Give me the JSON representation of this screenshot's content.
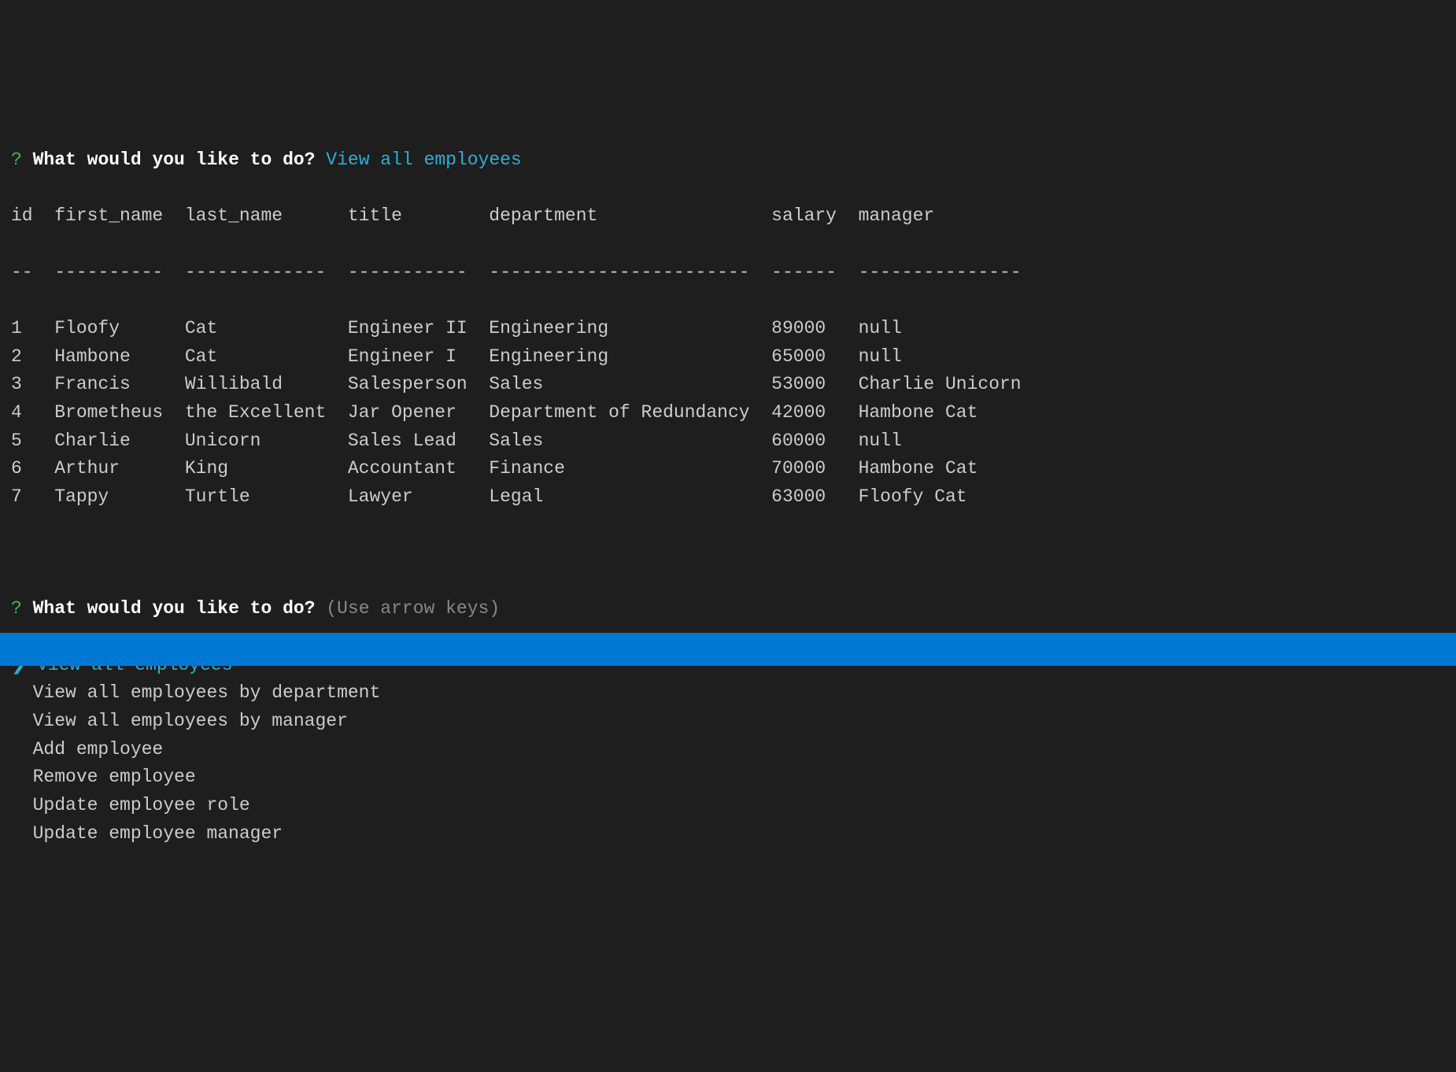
{
  "prompt1": {
    "qmark": "?",
    "question": "What would you like to do?",
    "answer": "View all employees"
  },
  "table": {
    "headers": [
      "id",
      "first_name",
      "last_name",
      "title",
      "department",
      "salary",
      "manager"
    ],
    "divider": [
      "--",
      "----------",
      "-------------",
      "-----------",
      "------------------------",
      "------",
      "---------------"
    ],
    "rows": [
      {
        "id": "1",
        "first_name": "Floofy",
        "last_name": "Cat",
        "title": "Engineer II",
        "department": "Engineering",
        "salary": "89000",
        "manager": "null"
      },
      {
        "id": "2",
        "first_name": "Hambone",
        "last_name": "Cat",
        "title": "Engineer I",
        "department": "Engineering",
        "salary": "65000",
        "manager": "null"
      },
      {
        "id": "3",
        "first_name": "Francis",
        "last_name": "Willibald",
        "title": "Salesperson",
        "department": "Sales",
        "salary": "53000",
        "manager": "Charlie Unicorn"
      },
      {
        "id": "4",
        "first_name": "Brometheus",
        "last_name": "the Excellent",
        "title": "Jar Opener",
        "department": "Department of Redundancy",
        "salary": "42000",
        "manager": "Hambone Cat"
      },
      {
        "id": "5",
        "first_name": "Charlie",
        "last_name": "Unicorn",
        "title": "Sales Lead",
        "department": "Sales",
        "salary": "60000",
        "manager": "null"
      },
      {
        "id": "6",
        "first_name": "Arthur",
        "last_name": "King",
        "title": "Accountant",
        "department": "Finance",
        "salary": "70000",
        "manager": "Hambone Cat"
      },
      {
        "id": "7",
        "first_name": "Tappy",
        "last_name": "Turtle",
        "title": "Lawyer",
        "department": "Legal",
        "salary": "63000",
        "manager": "Floofy Cat"
      }
    ]
  },
  "prompt2": {
    "qmark": "?",
    "question": "What would you like to do?",
    "hint": "(Use arrow keys)",
    "pointer": "❯"
  },
  "menu": {
    "items": [
      {
        "label": "View all employees",
        "selected": true
      },
      {
        "label": "View all employees by department",
        "selected": false
      },
      {
        "label": "View all employees by manager",
        "selected": false
      },
      {
        "label": "Add employee",
        "selected": false
      },
      {
        "label": "Remove employee",
        "selected": false
      },
      {
        "label": "Update employee role",
        "selected": false
      },
      {
        "label": "Update employee manager",
        "selected": false
      }
    ]
  },
  "col_widths": {
    "id": 4,
    "first_name": 12,
    "last_name": 15,
    "title": 13,
    "department": 26,
    "salary": 8,
    "manager": 15
  }
}
